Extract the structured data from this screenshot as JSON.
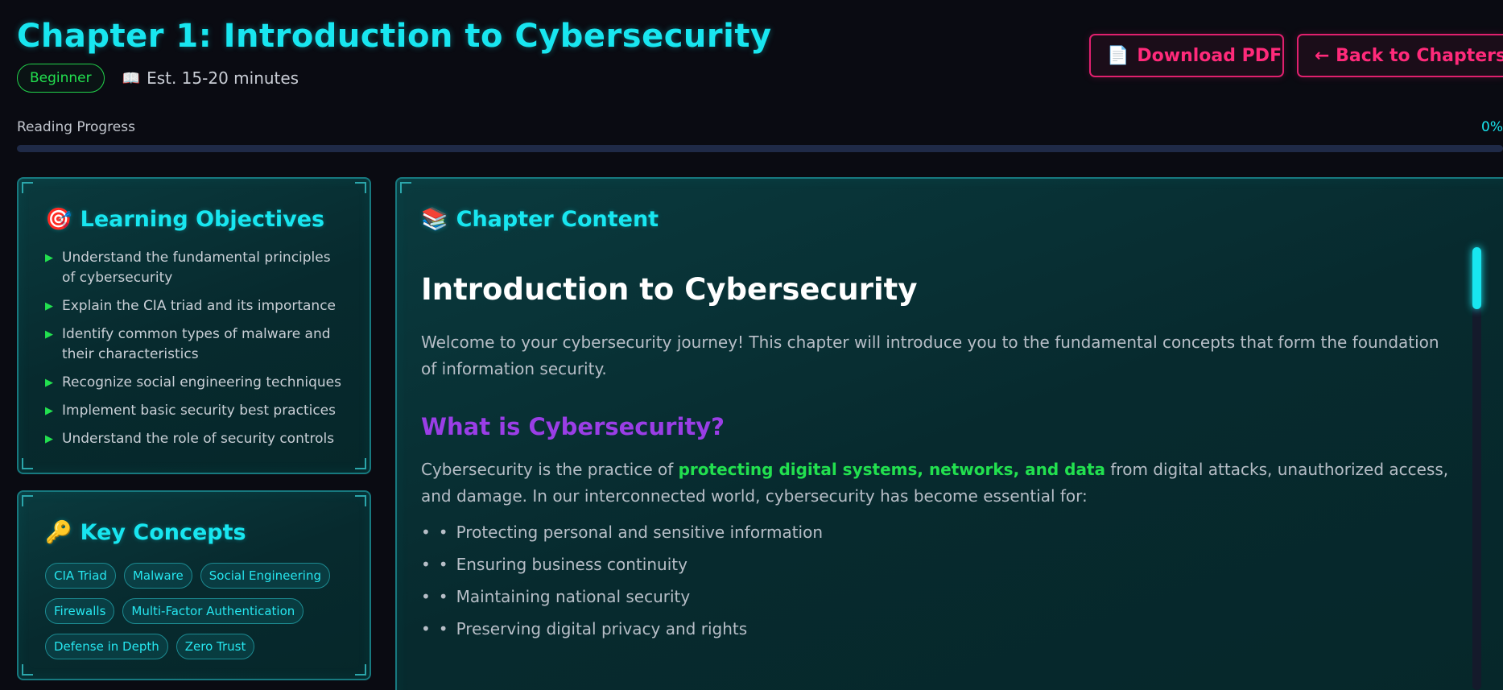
{
  "header": {
    "title": "Chapter 1: Introduction to Cybersecurity",
    "level_badge": "Beginner",
    "time_icon": "book-icon",
    "time_estimate": "Est. 15-20 minutes",
    "download_icon": "document-icon",
    "download_label": "Download PDF",
    "back_label": "← Back to Chapters"
  },
  "progress": {
    "label": "Reading Progress",
    "value_text": "0%",
    "value": 0
  },
  "objectives": {
    "icon": "target-icon",
    "title": "Learning Objectives",
    "items": [
      "Understand the fundamental principles of cybersecurity",
      "Explain the CIA triad and its importance",
      "Identify common types of malware and their characteristics",
      "Recognize social engineering techniques",
      "Implement basic security best practices",
      "Understand the role of security controls"
    ]
  },
  "key_concepts": {
    "icon": "key-icon",
    "title": "Key Concepts",
    "tags": [
      "CIA Triad",
      "Malware",
      "Social Engineering",
      "Firewalls",
      "Multi-Factor Authentication",
      "Defense in Depth",
      "Zero Trust"
    ]
  },
  "content": {
    "icon": "books-icon",
    "title": "Chapter Content",
    "heading": "Introduction to Cybersecurity",
    "intro": "Welcome to your cybersecurity journey! This chapter will introduce you to the fundamental concepts that form the foundation of information security.",
    "section_heading": "What is Cybersecurity?",
    "para_before": "Cybersecurity is the practice of ",
    "para_highlight": "protecting digital systems, networks, and data",
    "para_after": " from digital attacks, unauthorized access, and damage. In our interconnected world, cybersecurity has become essential for:",
    "bullets": [
      "Protecting personal and sensitive information",
      "Ensuring business continuity",
      "Maintaining national security",
      "Preserving digital privacy and rights"
    ]
  },
  "colors": {
    "accent_cyan": "#18e6f0",
    "accent_pink": "#ff2a7a",
    "accent_green": "#22e04f",
    "accent_purple": "#9a3ee6",
    "background": "#0a0b12"
  }
}
